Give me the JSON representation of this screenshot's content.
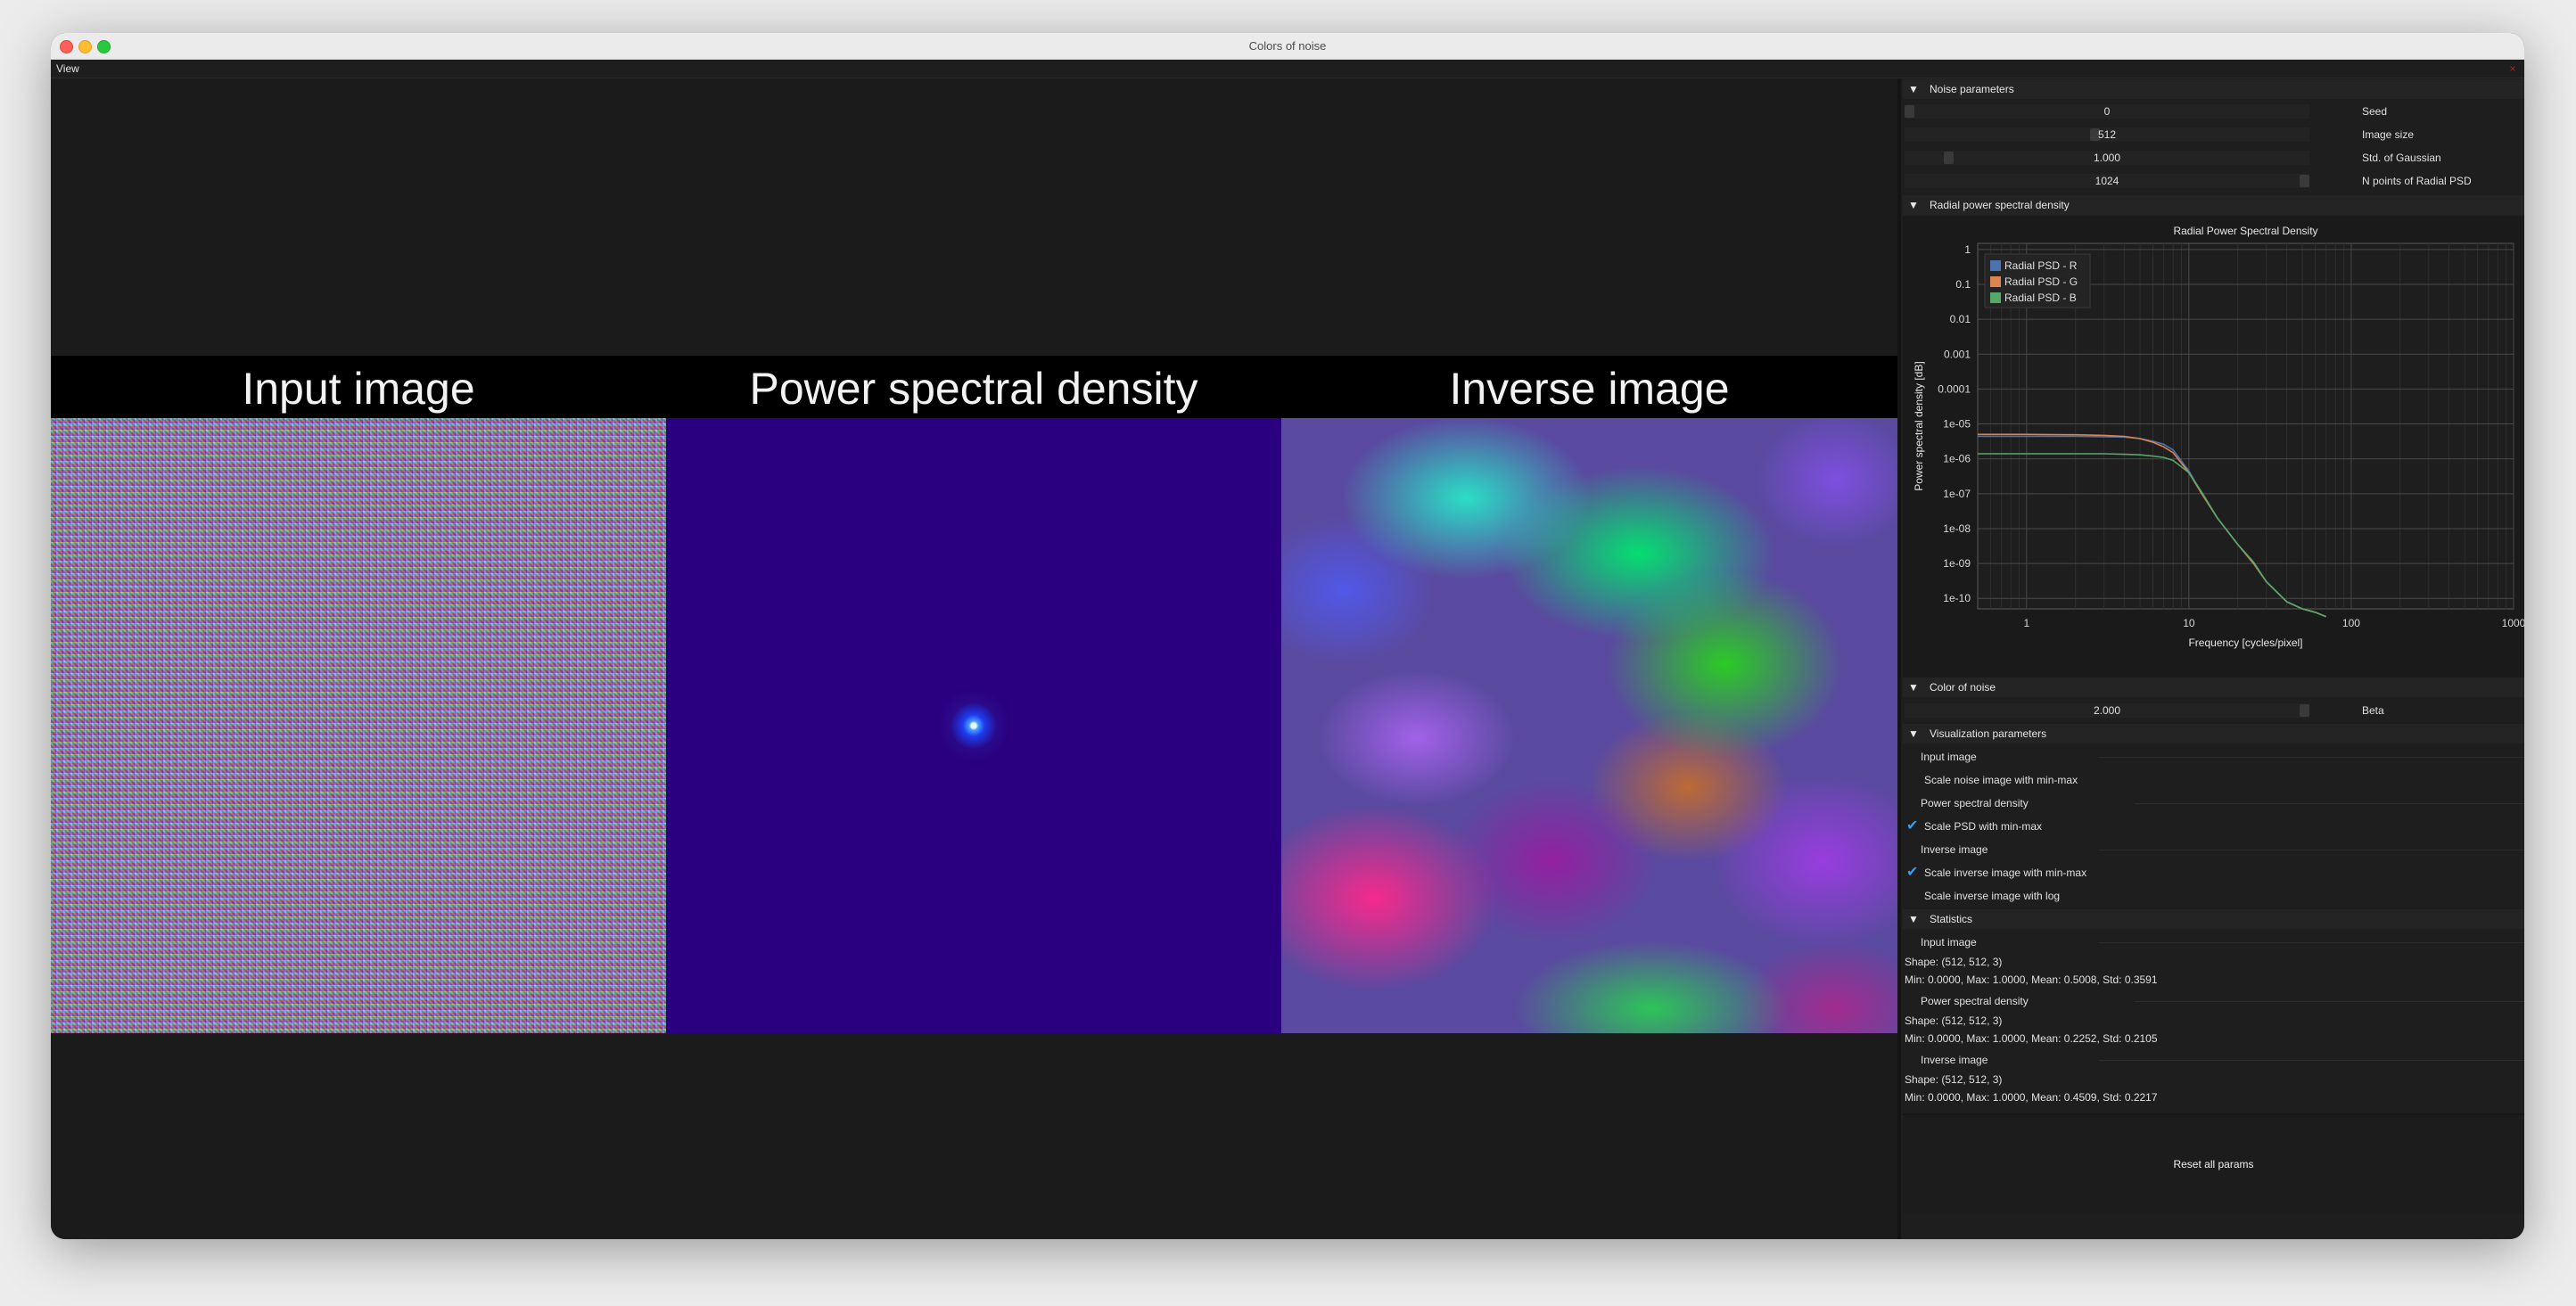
{
  "window": {
    "title": "Colors of noise"
  },
  "menu": {
    "view_label": "View",
    "close_icon": "×"
  },
  "viewport": {
    "input_caption": "Input image",
    "psd_caption": "Power spectral density",
    "inverse_caption": "Inverse image"
  },
  "noise_params": {
    "header": "Noise parameters",
    "seed": {
      "value": "0",
      "label": "Seed",
      "level": 0.0
    },
    "image_size": {
      "value": "512",
      "label": "Image size",
      "level": 0.47
    },
    "std_gaussian": {
      "value": "1.000",
      "label": "Std. of Gaussian",
      "level": 0.1
    },
    "n_points": {
      "value": "1024",
      "label": "N points of Radial PSD",
      "level": 1.0
    }
  },
  "radial_psd": {
    "header": "Radial power spectral density"
  },
  "color_of_noise": {
    "header": "Color of noise",
    "beta": {
      "value": "2.000",
      "label": "Beta",
      "level": 1.0
    }
  },
  "visualization": {
    "header": "Visualization parameters",
    "input_group": "Input image",
    "scale_noise_minmax": {
      "label": "Scale noise image with min-max",
      "checked": false
    },
    "psd_group": "Power spectral density",
    "scale_psd_minmax": {
      "label": "Scale PSD with min-max",
      "checked": true
    },
    "inverse_group": "Inverse image",
    "scale_inverse_minmax": {
      "label": "Scale inverse image with min-max",
      "checked": true
    },
    "scale_inverse_log": {
      "label": "Scale inverse image with log",
      "checked": false
    }
  },
  "statistics": {
    "header": "Statistics",
    "input": {
      "label": "Input image",
      "shape": "Shape: (512, 512, 3)",
      "stats": "Min: 0.0000, Max: 1.0000, Mean: 0.5008, Std: 0.3591"
    },
    "psd": {
      "label": "Power spectral density",
      "shape": "Shape: (512, 512, 3)",
      "stats": "Min: 0.0000, Max: 1.0000, Mean: 0.2252, Std: 0.2105"
    },
    "inverse": {
      "label": "Inverse image",
      "shape": "Shape: (512, 512, 3)",
      "stats": "Min: 0.0000, Max: 1.0000, Mean: 0.4509, Std: 0.2217"
    }
  },
  "reset_label": "Reset all params",
  "chart_data": {
    "type": "line",
    "title": "Radial Power Spectral Density",
    "xlabel": "Frequency [cycles/pixel]",
    "ylabel": "Power spectral density [dB]",
    "x_scale": "log",
    "y_scale": "log",
    "xlim": [
      0.5,
      1000
    ],
    "ylim": [
      5e-11,
      1.5
    ],
    "x_ticks": [
      {
        "value": 1,
        "label": "1"
      },
      {
        "value": 10,
        "label": "10"
      },
      {
        "value": 100,
        "label": "100"
      },
      {
        "value": 1000,
        "label": "1000"
      }
    ],
    "y_ticks": [
      {
        "value": 1,
        "label": "1"
      },
      {
        "value": 0.1,
        "label": "0.1"
      },
      {
        "value": 0.01,
        "label": "0.01"
      },
      {
        "value": 0.001,
        "label": "0.001"
      },
      {
        "value": 0.0001,
        "label": "0.0001"
      },
      {
        "value": 1e-05,
        "label": "1e-05"
      },
      {
        "value": 1e-06,
        "label": "1e-06"
      },
      {
        "value": 1e-07,
        "label": "1e-07"
      },
      {
        "value": 1e-08,
        "label": "1e-08"
      },
      {
        "value": 1e-09,
        "label": "1e-09"
      },
      {
        "value": 1e-10,
        "label": "1e-10"
      }
    ],
    "grid": true,
    "legend_position": "top-left",
    "series": [
      {
        "name": "Radial PSD - R",
        "color": "#4c72b0",
        "x": [
          0.5,
          1,
          2,
          3,
          4,
          5,
          6,
          7,
          8,
          10,
          12,
          15,
          20,
          25,
          30,
          40,
          50,
          60,
          70
        ],
        "y": [
          4.4e-06,
          4.4e-06,
          4.4e-06,
          4.3e-06,
          4.2e-06,
          3.8e-06,
          3.2e-06,
          2.6e-06,
          1.8e-06,
          4.5e-07,
          1e-07,
          2e-08,
          3.5e-09,
          1.1e-09,
          3e-10,
          8e-11,
          5e-11,
          4e-11,
          3e-11
        ]
      },
      {
        "name": "Radial PSD - G",
        "color": "#dd8452",
        "x": [
          0.5,
          1,
          2,
          3,
          4,
          5,
          6,
          7,
          8,
          10,
          12,
          15,
          20,
          25,
          30,
          40,
          50,
          60,
          70
        ],
        "y": [
          5e-06,
          5e-06,
          4.9e-06,
          4.7e-06,
          4.4e-06,
          3.8e-06,
          3e-06,
          2.2e-06,
          1.5e-06,
          4e-07,
          1e-07,
          2e-08,
          3.5e-09,
          1e-09,
          3e-10,
          8e-11,
          5e-11,
          4e-11,
          3e-11
        ]
      },
      {
        "name": "Radial PSD - B",
        "color": "#55a868",
        "x": [
          0.5,
          1,
          2,
          3,
          4,
          5,
          6,
          7,
          8,
          10,
          12,
          15,
          20,
          25,
          30,
          40,
          50,
          60,
          70
        ],
        "y": [
          1.4e-06,
          1.4e-06,
          1.4e-06,
          1.4e-06,
          1.35e-06,
          1.3e-06,
          1.2e-06,
          1.1e-06,
          9e-07,
          4e-07,
          1.1e-07,
          2e-08,
          3.5e-09,
          1.1e-09,
          3e-10,
          8e-11,
          5e-11,
          4e-11,
          3e-11
        ]
      }
    ]
  },
  "colors": {
    "background": "#1b1b1b",
    "panel": "#1e1e1e",
    "checkmark": "#3d9be9",
    "psd_background": "#2b0080"
  }
}
